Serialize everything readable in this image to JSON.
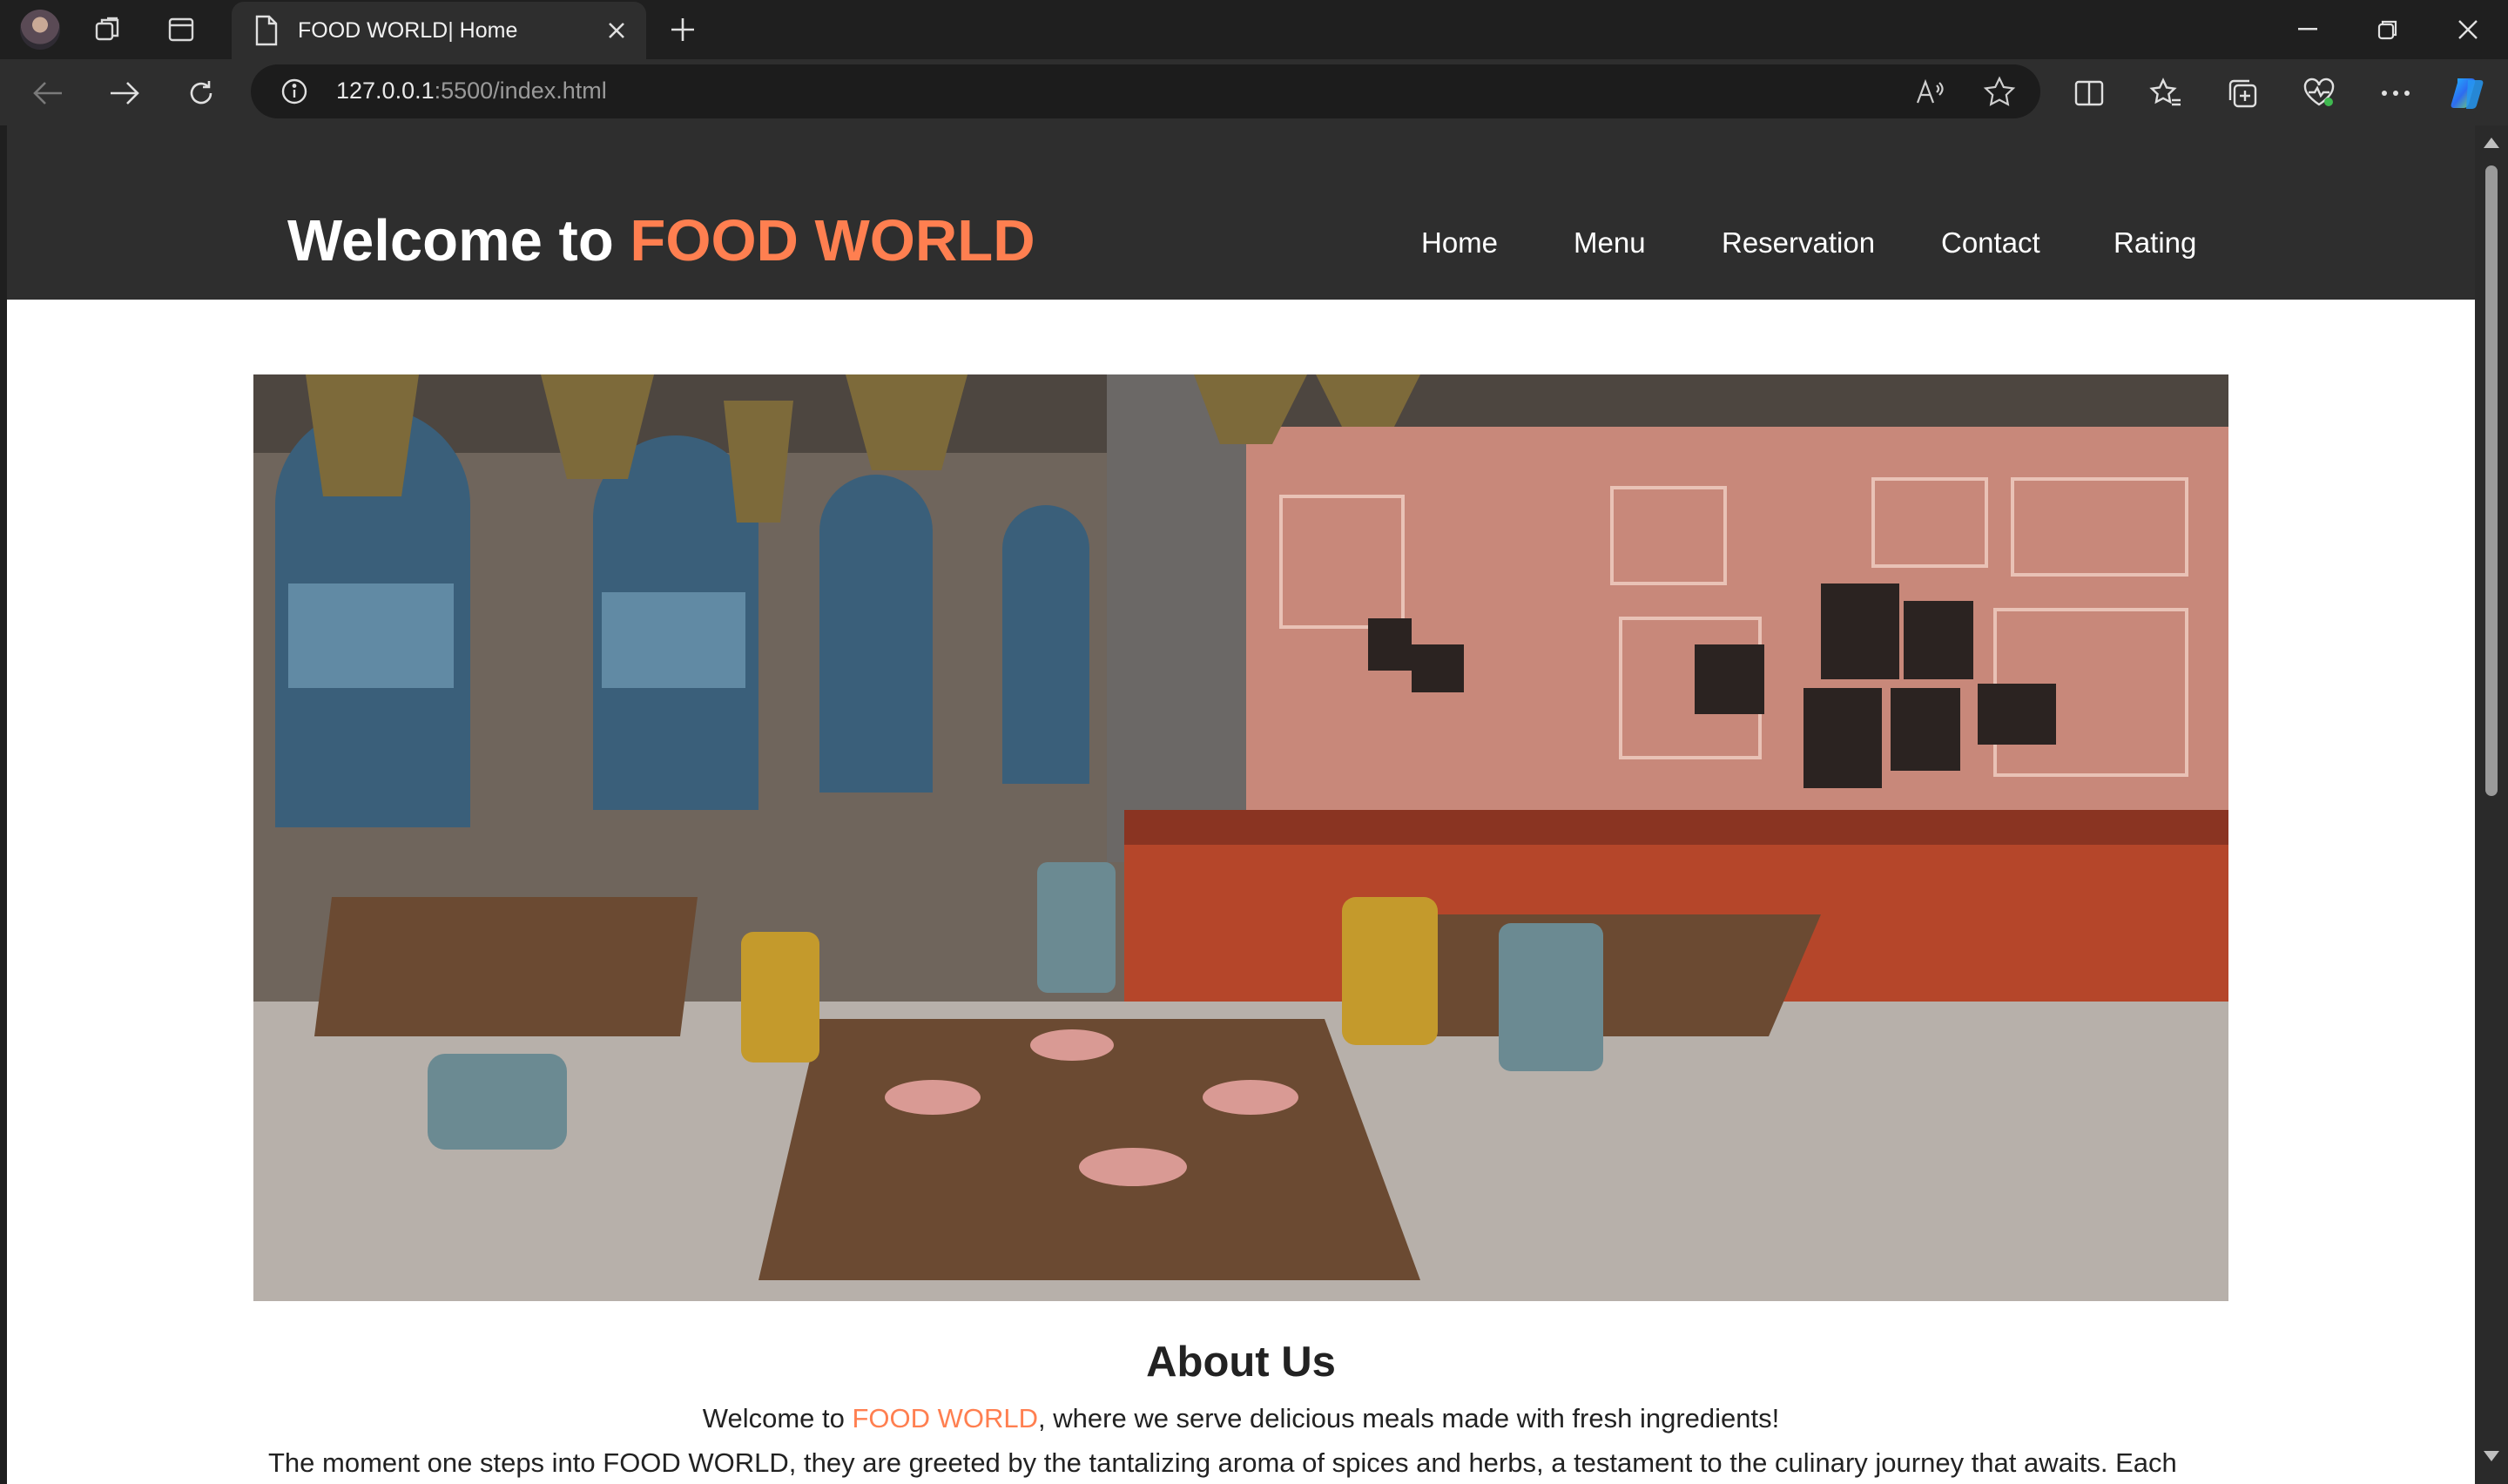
{
  "browser": {
    "tab_title": "FOOD WORLD| Home",
    "url_host": "127.0.0.1",
    "url_rest": ":5500/index.html"
  },
  "site": {
    "title_prefix": "Welcome to ",
    "brand": "FOOD WORLD",
    "nav": [
      "Home",
      "Menu",
      "Reservation",
      "Contact",
      "Rating"
    ]
  },
  "about": {
    "heading": "About Us",
    "intro_before": "Welcome to ",
    "intro_brand": "FOOD WORLD",
    "intro_after": ", where we serve delicious meals made with fresh ingredients!",
    "paragraph": "The moment one steps into FOOD WORLD, they are greeted by the tantalizing aroma of spices and herbs, a testament to the culinary journey that awaits. Each"
  },
  "colors": {
    "accent": "#ff7f50",
    "header_bg": "#2e2e2e"
  },
  "icons": [
    "avatar",
    "workspaces-icon",
    "tab-actions-icon",
    "page-icon",
    "close-icon",
    "plus-icon",
    "minimize-icon",
    "restore-icon",
    "close-window-icon",
    "back-arrow-icon",
    "forward-arrow-icon",
    "reload-icon",
    "info-icon",
    "read-aloud-icon",
    "star-icon",
    "split-screen-icon",
    "favorites-icon",
    "collections-icon",
    "health-icon",
    "more-icon",
    "copilot-icon"
  ]
}
